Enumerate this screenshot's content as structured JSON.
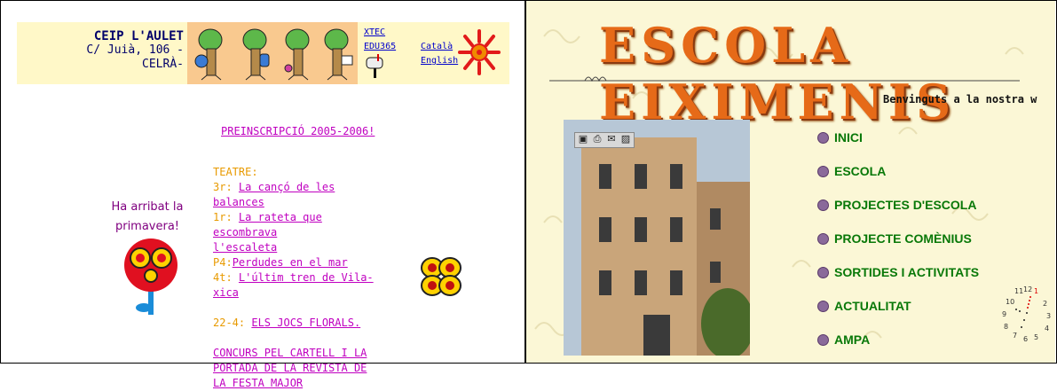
{
  "left": {
    "school": {
      "name": "CEIP L'AULET",
      "address": "C/ Juià, 106 -",
      "town": "CELRÀ-"
    },
    "top_links": [
      "XTEC",
      "EDU365"
    ],
    "languages": [
      "Català",
      "English"
    ],
    "preinscription_link": "PREINSCRIPCIÓ 2005-2006!",
    "spring_text": [
      "Ha arribat la",
      "primavera!"
    ],
    "theatre": {
      "heading": "TEATRE:",
      "items": [
        {
          "prefix": "3r:",
          "link": "La cançó de les balances"
        },
        {
          "prefix": "1r:",
          "link": "La rateta que escombrava"
        },
        {
          "prefix": "",
          "link": "l'escaleta"
        },
        {
          "prefix": "P4:",
          "link": "Perdudes en el mar"
        },
        {
          "prefix": "4t:",
          "link": "L'últim tren de Vila-xica"
        }
      ]
    },
    "event": {
      "prefix": "22-4:",
      "link": "ELS JOCS FLORALS."
    },
    "contest_lines": [
      "CONCURS PEL CARTELL I LA",
      "PORTADA DE LA REVISTA DE",
      "LA FESTA MAJOR"
    ]
  },
  "right": {
    "title": "ESCOLA EIXIMENIS",
    "welcome": "Benvinguts a la nostra w",
    "menu": [
      "INICI",
      "ESCOLA",
      "PROJECTES D'ESCOLA",
      "PROJECTE COMÈNIUS",
      "SORTIDES I ACTIVITATS",
      "ACTUALITAT",
      "AMPA"
    ],
    "toolbar_icons": [
      "save-icon",
      "print-icon",
      "mail-icon",
      "image-icon"
    ],
    "clock_numbers": [
      "11",
      "12",
      "1",
      "10",
      "2",
      "9",
      "3",
      "8",
      "4",
      "7",
      "6",
      "5"
    ]
  },
  "colors": {
    "header_bg": "#fff8c8",
    "trees_bg": "#f9c98f",
    "link": "#c000c0",
    "orange": "#e89a00",
    "menu_green": "#087808",
    "title_orange": "#e66a18"
  }
}
